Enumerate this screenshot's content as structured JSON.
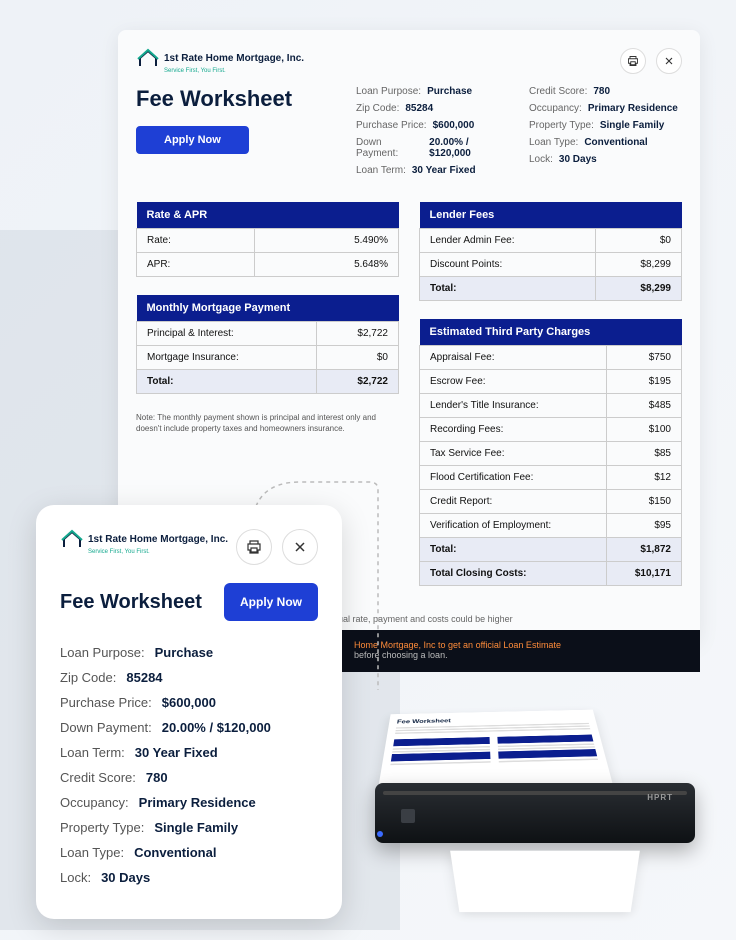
{
  "company": {
    "name": "1st Rate Home Mortgage, Inc.",
    "tagline": "Service First, You First."
  },
  "title": "Fee Worksheet",
  "apply_label": "Apply Now",
  "details": {
    "loan_purpose": {
      "label": "Loan Purpose:",
      "value": "Purchase"
    },
    "zip_code": {
      "label": "Zip Code:",
      "value": "85284"
    },
    "purchase_price": {
      "label": "Purchase Price:",
      "value": "$600,000"
    },
    "down_payment": {
      "label": "Down Payment:",
      "value": "20.00% / $120,000"
    },
    "loan_term": {
      "label": "Loan Term:",
      "value": "30 Year Fixed"
    },
    "credit_score": {
      "label": "Credit Score:",
      "value": "780"
    },
    "occupancy": {
      "label": "Occupancy:",
      "value": "Primary Residence"
    },
    "property_type": {
      "label": "Property Type:",
      "value": "Single Family"
    },
    "loan_type": {
      "label": "Loan Type:",
      "value": "Conventional"
    },
    "lock": {
      "label": "Lock:",
      "value": "30 Days"
    }
  },
  "rate_apr": {
    "header": "Rate & APR",
    "rows": [
      {
        "label": "Rate:",
        "value": "5.490%"
      },
      {
        "label": "APR:",
        "value": "5.648%"
      }
    ]
  },
  "lender_fees": {
    "header": "Lender Fees",
    "rows": [
      {
        "label": "Lender Admin Fee:",
        "value": "$0"
      },
      {
        "label": "Discount Points:",
        "value": "$8,299"
      }
    ],
    "total": {
      "label": "Total:",
      "value": "$8,299"
    }
  },
  "monthly_payment": {
    "header": "Monthly Mortgage Payment",
    "rows": [
      {
        "label": "Principal & Interest:",
        "value": "$2,722"
      },
      {
        "label": "Mortgage Insurance:",
        "value": "$0"
      }
    ],
    "total": {
      "label": "Total:",
      "value": "$2,722"
    },
    "note": "Note: The monthly payment shown is principal and interest only and doesn't include property taxes and homeowners insurance."
  },
  "third_party": {
    "header": "Estimated Third Party Charges",
    "rows": [
      {
        "label": "Appraisal Fee:",
        "value": "$750"
      },
      {
        "label": "Escrow Fee:",
        "value": "$195"
      },
      {
        "label": "Lender's Title Insurance:",
        "value": "$485"
      },
      {
        "label": "Recording Fees:",
        "value": "$100"
      },
      {
        "label": "Tax Service Fee:",
        "value": "$85"
      },
      {
        "label": "Flood Certification Fee:",
        "value": "$12"
      },
      {
        "label": "Credit Report:",
        "value": "$150"
      },
      {
        "label": "Verification of Employment:",
        "value": "$95"
      }
    ],
    "total": {
      "label": "Total:",
      "value": "$1,872"
    },
    "closing": {
      "label": "Total Closing Costs:",
      "value": "$10,171"
    }
  },
  "disclaimer": "Your actual rate, payment and costs could be higher",
  "dark_strip": {
    "line1": "Home Mortgage, Inc to get an official Loan Estimate",
    "line2": "before choosing a loan."
  },
  "printer_brand": "HPRT"
}
